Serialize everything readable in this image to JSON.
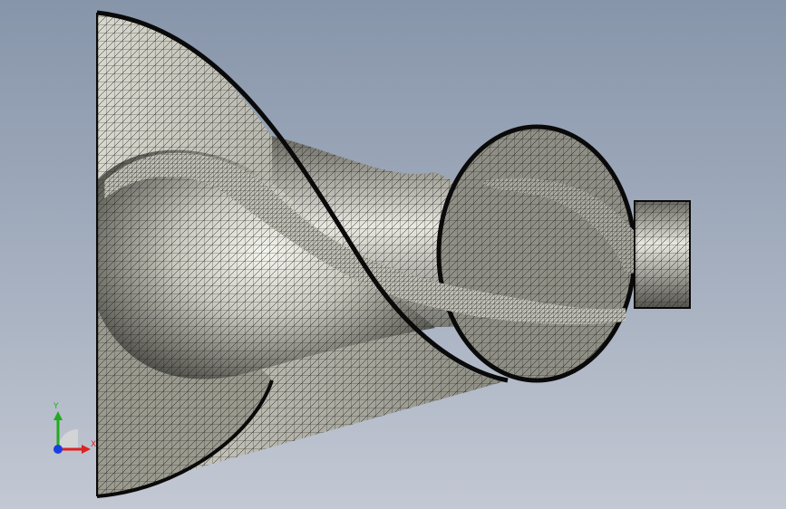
{
  "view": {
    "background_top": "#8795aa",
    "background_bottom": "#c3c8d3",
    "mesh_line_color": "#1a1a1a",
    "surface_light": "#f2f2ea",
    "surface_dark": "#4a4a44"
  },
  "triad": {
    "y_label": "Y",
    "x_label": "X",
    "y_color": "#22aa22",
    "x_color": "#dd2222",
    "z_color": "#1a3fe0"
  }
}
